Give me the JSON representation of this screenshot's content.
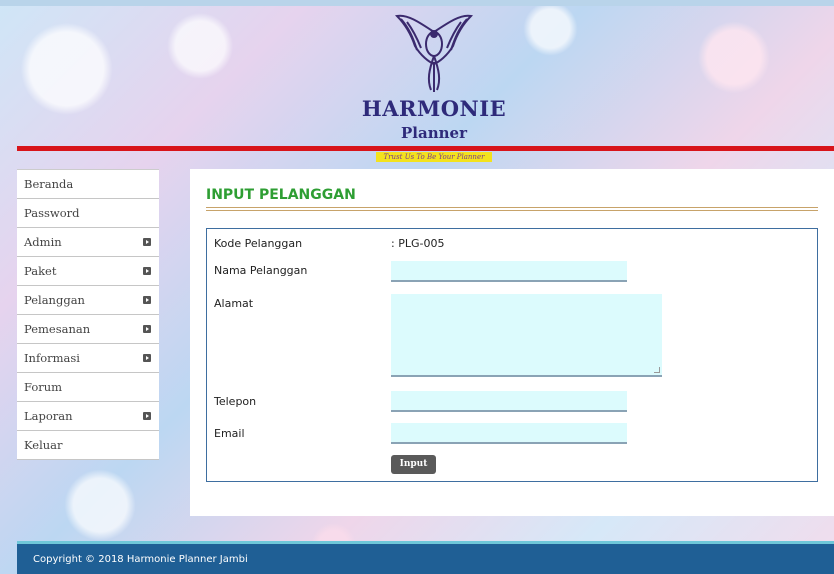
{
  "header": {
    "brand_main": "HARMONIE",
    "brand_sub": "Planner",
    "tagline": "Trust Us To Be Your Planner"
  },
  "sidebar": {
    "items": [
      {
        "label": "Beranda",
        "has_submenu": false
      },
      {
        "label": "Password",
        "has_submenu": false
      },
      {
        "label": "Admin",
        "has_submenu": true
      },
      {
        "label": "Paket",
        "has_submenu": true
      },
      {
        "label": "Pelanggan",
        "has_submenu": true
      },
      {
        "label": "Pemesanan",
        "has_submenu": true
      },
      {
        "label": "Informasi",
        "has_submenu": true
      },
      {
        "label": "Forum",
        "has_submenu": false
      },
      {
        "label": "Laporan",
        "has_submenu": true
      },
      {
        "label": "Keluar",
        "has_submenu": false
      }
    ]
  },
  "main": {
    "title": "INPUT PELANGGAN",
    "form": {
      "kode_label": "Kode Pelanggan",
      "kode_value": ": PLG-005",
      "nama_label": "Nama Pelanggan",
      "nama_value": "",
      "alamat_label": "Alamat",
      "alamat_value": "",
      "telepon_label": "Telepon",
      "telepon_value": "",
      "email_label": "Email",
      "email_value": "",
      "submit_label": "Input"
    }
  },
  "footer": {
    "text": "Copyright © 2018 Harmonie Planner Jambi"
  },
  "colors": {
    "accent_red": "#d8141a",
    "title_green": "#2e9e33",
    "footer_blue": "#1f5f95",
    "input_bg": "#dcfbfd"
  }
}
